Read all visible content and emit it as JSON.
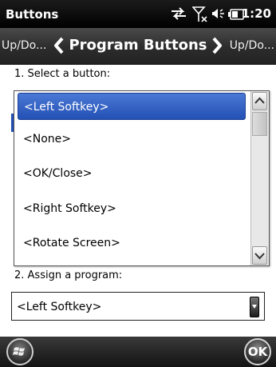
{
  "status_bar": {
    "title": "Buttons",
    "time": "1:20",
    "icons": [
      "sync-arrows-icon",
      "no-signal-icon",
      "speaker-icon",
      "battery-icon"
    ]
  },
  "nav": {
    "left_label": "Up/Do...",
    "title": "Program Buttons",
    "right_label": "Up/Do..."
  },
  "form": {
    "select_label": "1. Select a button:",
    "assign_label": "2. Assign a program:",
    "assign_value": "<Left Softkey>"
  },
  "dropdown": {
    "items": [
      "<Left Softkey>",
      "<None>",
      "<OK/Close>",
      "<Right Softkey>",
      "<Rotate Screen>"
    ],
    "selected_index": 0
  },
  "bottom_bar": {
    "ok_label": "OK"
  },
  "colors": {
    "selection": "#2b5bc4",
    "bar_dark": "#1a1a1a"
  }
}
